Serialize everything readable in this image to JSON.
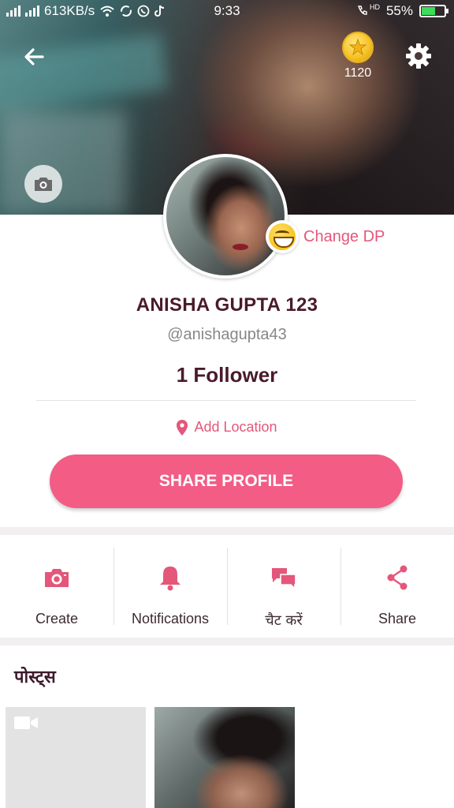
{
  "status_bar": {
    "network_speed": "613KB/s",
    "time": "9:33",
    "battery_percent": "55%",
    "hd_label": "HD"
  },
  "header": {
    "coin_count": "1120"
  },
  "profile": {
    "change_dp_label": "Change DP",
    "name": "ANISHA GUPTA 123",
    "handle": "@anishagupta43",
    "followers": "1 Follower",
    "location_label": "Add Location",
    "share_button_label": "SHARE PROFILE"
  },
  "actions": [
    {
      "label": "Create",
      "icon": "camera-icon"
    },
    {
      "label": "Notifications",
      "icon": "bell-icon"
    },
    {
      "label": "चैट करें",
      "icon": "chat-bubbles-icon"
    },
    {
      "label": "Share",
      "icon": "share-icon"
    }
  ],
  "posts": {
    "title": "पोस्ट्स"
  },
  "colors": {
    "accent": "#f25c85",
    "accent_text": "#e4577a",
    "title_text": "#4a1a2c"
  }
}
